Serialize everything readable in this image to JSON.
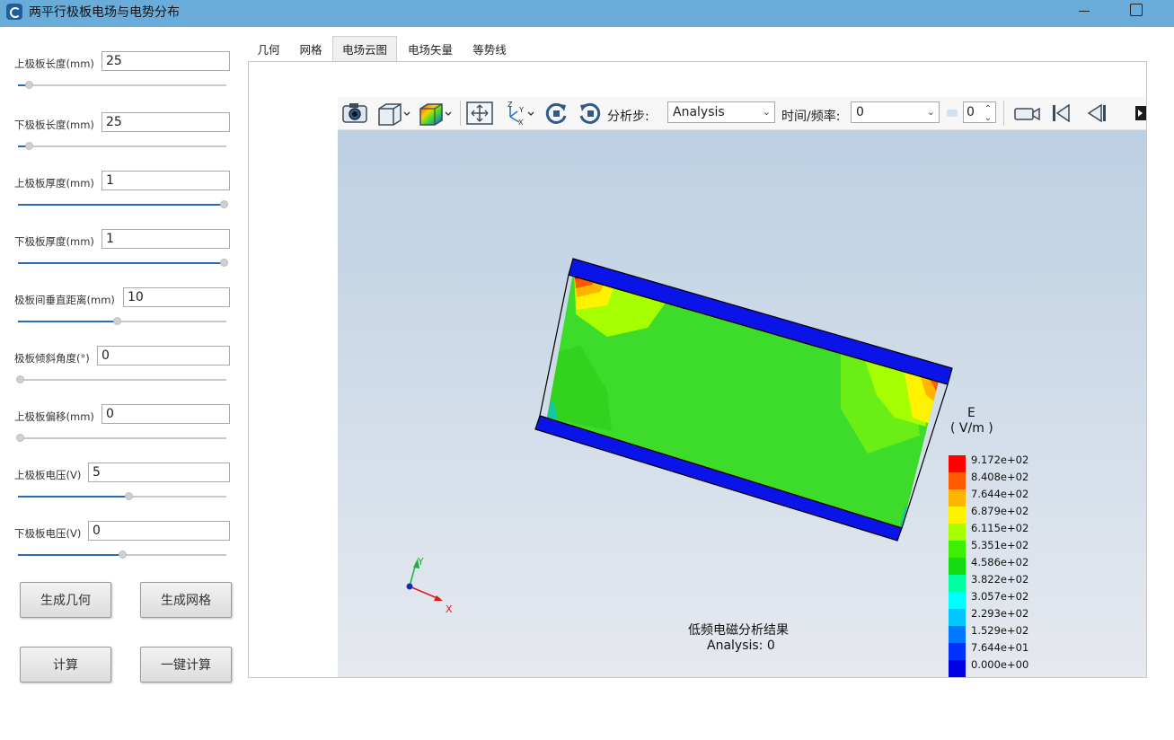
{
  "window": {
    "title": "两平行极板电场与电势分布"
  },
  "params": [
    {
      "label": "上极板长度(mm)",
      "value": "25",
      "slider": 0.05
    },
    {
      "label": "下极板长度(mm)",
      "value": "25",
      "slider": 0.05
    },
    {
      "label": "上极板厚度(mm)",
      "value": "1",
      "slider": 1.0
    },
    {
      "label": "下极板厚度(mm)",
      "value": "1",
      "slider": 1.0
    },
    {
      "label": "极板间垂直距离(mm)",
      "value": "10",
      "slider": 0.47
    },
    {
      "label": "极板倾斜角度(°)",
      "value": "0",
      "slider": 0.0
    },
    {
      "label": "上极板偏移(mm)",
      "value": "0",
      "slider": 0.0
    },
    {
      "label": "上极板电压(V)",
      "value": "5",
      "slider": 0.53
    },
    {
      "label": "下极板电压(V)",
      "value": "0",
      "slider": 0.5
    }
  ],
  "buttons": {
    "gen_geometry": "生成几何",
    "gen_mesh": "生成网格",
    "compute": "计算",
    "one_click": "一键计算"
  },
  "tabs": [
    "几何",
    "网格",
    "电场云图",
    "电场矢量",
    "等势线"
  ],
  "active_tab": "电场云图",
  "toolbar": {
    "step_label": "分析步:",
    "step_value": "Analysis",
    "time_label": "时间/频率:",
    "time_value": "0",
    "spin_value": "0"
  },
  "viewport": {
    "result_title": "低频电磁分析结果",
    "result_sub": "Analysis: 0",
    "axes": {
      "x": "X",
      "y": "Y"
    }
  },
  "legend": {
    "quantity": "E",
    "unit": "( V/m )",
    "values": [
      "9.172e+02",
      "8.408e+02",
      "7.644e+02",
      "6.879e+02",
      "6.115e+02",
      "5.351e+02",
      "4.586e+02",
      "3.822e+02",
      "3.057e+02",
      "2.293e+02",
      "1.529e+02",
      "7.644e+01",
      "0.000e+00"
    ],
    "colors": [
      "#ff0000",
      "#ff5a00",
      "#ffb400",
      "#fff200",
      "#a6ff00",
      "#3df000",
      "#13dc13",
      "#00ffa0",
      "#00ffff",
      "#00c8ff",
      "#0078ff",
      "#0032ff",
      "#0000e6"
    ]
  }
}
